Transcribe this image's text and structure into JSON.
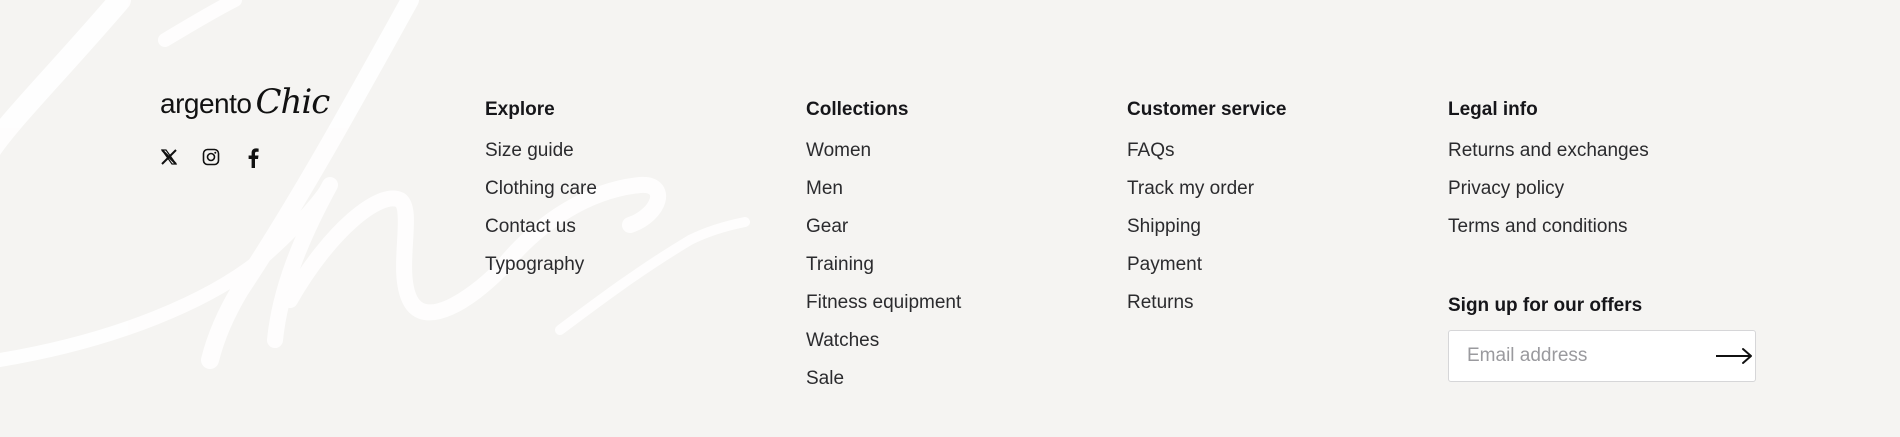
{
  "brand": {
    "logo_word": "argento",
    "logo_script": "Chic",
    "social_icons": [
      "x-icon",
      "instagram-icon",
      "facebook-icon"
    ]
  },
  "columns": {
    "explore": {
      "title": "Explore",
      "links": [
        "Size guide",
        "Clothing care",
        "Contact us",
        "Typography"
      ]
    },
    "collections": {
      "title": "Collections",
      "links": [
        "Women",
        "Men",
        "Gear",
        "Training",
        "Fitness equipment",
        "Watches",
        "Sale"
      ]
    },
    "customer_service": {
      "title": "Customer service",
      "links": [
        "FAQs",
        "Track my order",
        "Shipping",
        "Payment",
        "Returns"
      ]
    },
    "legal": {
      "title": "Legal info",
      "links": [
        "Returns and exchanges",
        "Privacy policy",
        "Terms and conditions"
      ]
    }
  },
  "newsletter": {
    "title": "Sign up for our offers",
    "placeholder": "Email address"
  },
  "colors": {
    "background": "#f5f4f2",
    "text": "#1d1d1f",
    "watermark": "#ffffff"
  }
}
